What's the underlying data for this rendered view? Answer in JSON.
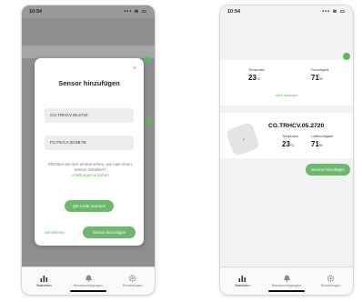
{
  "left": {
    "status": {
      "time": "10:54",
      "signal": "••• ≋ ▭"
    },
    "dialog": {
      "close": "×",
      "title": "Sensor hinzufügen",
      "field1": "CG.TRHCV.05.2720",
      "field2": "FC:F5:CA:20:68:78",
      "note": "Möchten Sie sich einmal sehen, wie man einen Sensor installiert?",
      "note_link": "Anleitungen ansehen",
      "scan_button": "QR-Code scannen",
      "cancel": "Annullieren",
      "add_button": "Sensor hinzufügen"
    }
  },
  "right": {
    "status": {
      "time": "10:54",
      "signal": "••• ≋ ▭"
    },
    "card1": {
      "temp_label": "Temperatur",
      "temp_value": "23",
      "temp_unit": "°C",
      "hum_label": "Feuchtigkeit",
      "hum_value": "71",
      "hum_unit": "%",
      "more": "Mehr anzeigen"
    },
    "card2": {
      "device_name": "CG.TRHCV.05.2720",
      "temp_label": "Temperatur",
      "temp_value": "23",
      "temp_unit": "°C",
      "hum_label": "Luftfeuchtigkeit",
      "hum_value": "71",
      "hum_unit": "%"
    },
    "add_button": "Sensor hinzufügen"
  },
  "tabs": [
    {
      "label": "Statistiken",
      "icon": "bar-chart-icon"
    },
    {
      "label": "Benachrichtigungen",
      "icon": "bell-icon"
    },
    {
      "label": "Einstellungen",
      "icon": "gear-icon"
    }
  ],
  "colors": {
    "accent": "#5cb85c"
  }
}
